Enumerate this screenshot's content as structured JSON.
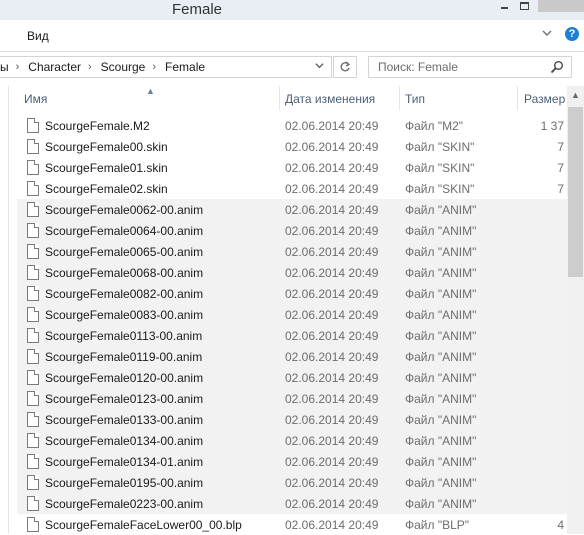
{
  "window": {
    "title": "Female"
  },
  "ribbon": {
    "view_tab": "Вид",
    "help_glyph": "?"
  },
  "address": {
    "crumbs": [
      "ы",
      "Character",
      "Scourge",
      "Female"
    ]
  },
  "search": {
    "placeholder": "Поиск: Female"
  },
  "columns": {
    "name": "Имя",
    "date": "Дата изменения",
    "type": "Тип",
    "size": "Размер"
  },
  "files": [
    {
      "name": "ScourgeFemale.M2",
      "date": "02.06.2014 20:49",
      "type": "Файл \"M2\"",
      "size": "1 37"
    },
    {
      "name": "ScourgeFemale00.skin",
      "date": "02.06.2014 20:49",
      "type": "Файл \"SKIN\"",
      "size": "7"
    },
    {
      "name": "ScourgeFemale01.skin",
      "date": "02.06.2014 20:49",
      "type": "Файл \"SKIN\"",
      "size": "7"
    },
    {
      "name": "ScourgeFemale02.skin",
      "date": "02.06.2014 20:49",
      "type": "Файл \"SKIN\"",
      "size": "7"
    },
    {
      "name": "ScourgeFemale0062-00.anim",
      "date": "02.06.2014 20:49",
      "type": "Файл \"ANIM\"",
      "size": ""
    },
    {
      "name": "ScourgeFemale0064-00.anim",
      "date": "02.06.2014 20:49",
      "type": "Файл \"ANIM\"",
      "size": ""
    },
    {
      "name": "ScourgeFemale0065-00.anim",
      "date": "02.06.2014 20:49",
      "type": "Файл \"ANIM\"",
      "size": ""
    },
    {
      "name": "ScourgeFemale0068-00.anim",
      "date": "02.06.2014 20:49",
      "type": "Файл \"ANIM\"",
      "size": ""
    },
    {
      "name": "ScourgeFemale0082-00.anim",
      "date": "02.06.2014 20:49",
      "type": "Файл \"ANIM\"",
      "size": ""
    },
    {
      "name": "ScourgeFemale0083-00.anim",
      "date": "02.06.2014 20:49",
      "type": "Файл \"ANIM\"",
      "size": ""
    },
    {
      "name": "ScourgeFemale0113-00.anim",
      "date": "02.06.2014 20:49",
      "type": "Файл \"ANIM\"",
      "size": ""
    },
    {
      "name": "ScourgeFemale0119-00.anim",
      "date": "02.06.2014 20:49",
      "type": "Файл \"ANIM\"",
      "size": ""
    },
    {
      "name": "ScourgeFemale0120-00.anim",
      "date": "02.06.2014 20:49",
      "type": "Файл \"ANIM\"",
      "size": ""
    },
    {
      "name": "ScourgeFemale0123-00.anim",
      "date": "02.06.2014 20:49",
      "type": "Файл \"ANIM\"",
      "size": ""
    },
    {
      "name": "ScourgeFemale0133-00.anim",
      "date": "02.06.2014 20:49",
      "type": "Файл \"ANIM\"",
      "size": ""
    },
    {
      "name": "ScourgeFemale0134-00.anim",
      "date": "02.06.2014 20:49",
      "type": "Файл \"ANIM\"",
      "size": ""
    },
    {
      "name": "ScourgeFemale0134-01.anim",
      "date": "02.06.2014 20:49",
      "type": "Файл \"ANIM\"",
      "size": ""
    },
    {
      "name": "ScourgeFemale0195-00.anim",
      "date": "02.06.2014 20:49",
      "type": "Файл \"ANIM\"",
      "size": ""
    },
    {
      "name": "ScourgeFemale0223-00.anim",
      "date": "02.06.2014 20:49",
      "type": "Файл \"ANIM\"",
      "size": ""
    },
    {
      "name": "ScourgeFemaleFaceLower00_00.blp",
      "date": "02.06.2014 20:49",
      "type": "Файл \"BLP\"",
      "size": "4"
    }
  ]
}
